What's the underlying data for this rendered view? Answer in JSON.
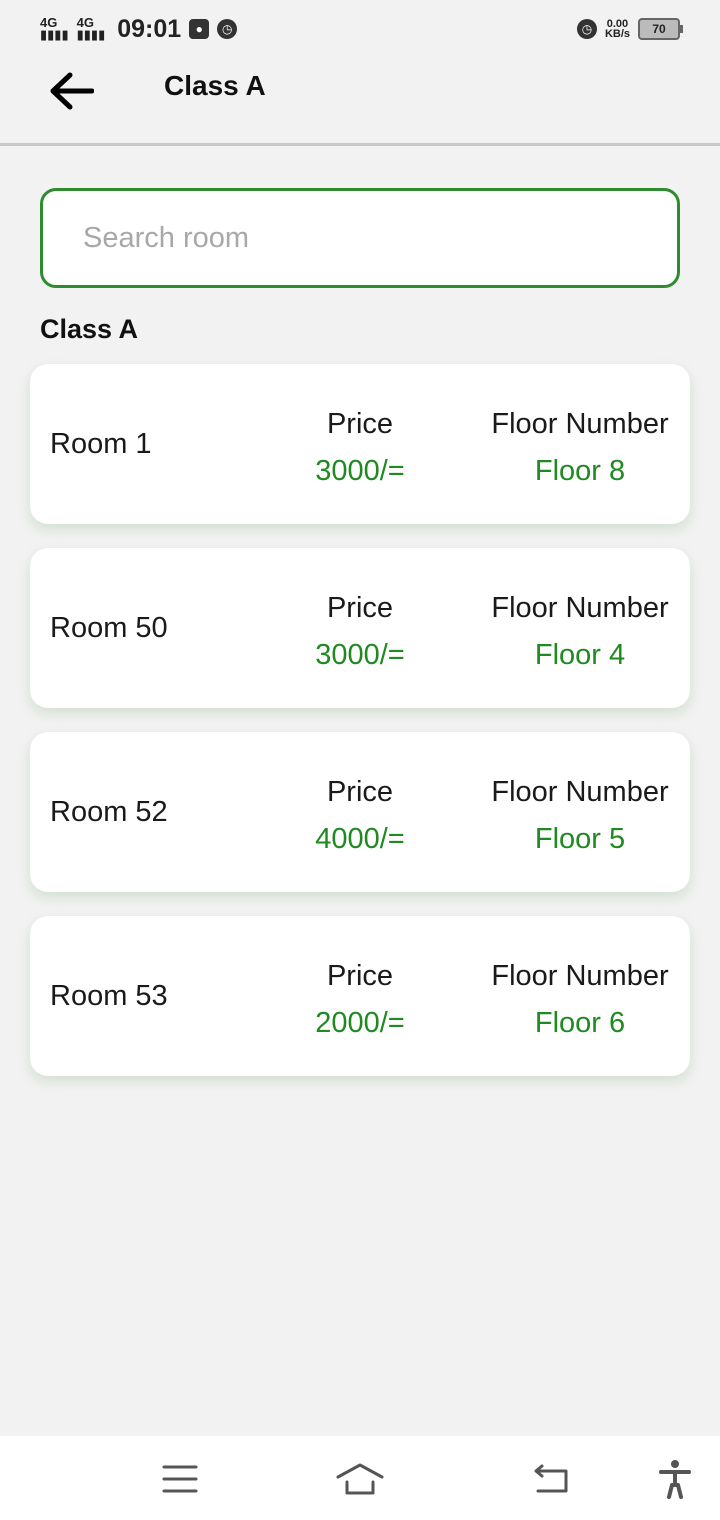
{
  "status_bar": {
    "signal1": "4G",
    "signal2": "4G",
    "time": "09:01",
    "net_speed_value": "0.00",
    "net_speed_unit": "KB/s",
    "battery": "70"
  },
  "app_bar": {
    "title": "Class A"
  },
  "search": {
    "placeholder": "Search room",
    "value": ""
  },
  "section_title": "Class A",
  "rooms": [
    {
      "name": "Room 1",
      "price_label": "Price",
      "price": "3000/=",
      "floor_label": "Floor Number",
      "floor": "Floor 8"
    },
    {
      "name": "Room 50",
      "price_label": "Price",
      "price": "3000/=",
      "floor_label": "Floor Number",
      "floor": "Floor 4"
    },
    {
      "name": "Room 52",
      "price_label": "Price",
      "price": "4000/=",
      "floor_label": "Floor Number",
      "floor": "Floor 5"
    },
    {
      "name": "Room 53",
      "price_label": "Price",
      "price": "2000/=",
      "floor_label": "Floor Number",
      "floor": "Floor 6"
    }
  ],
  "colors": {
    "accent": "#2e8b2e",
    "value_text": "#1f8a1f",
    "background": "#f2f2f2"
  },
  "icons": {
    "back": "arrow-left-icon",
    "nav_menu": "menu-icon",
    "nav_home": "home-icon",
    "nav_back": "back-icon",
    "accessibility": "accessibility-icon"
  }
}
